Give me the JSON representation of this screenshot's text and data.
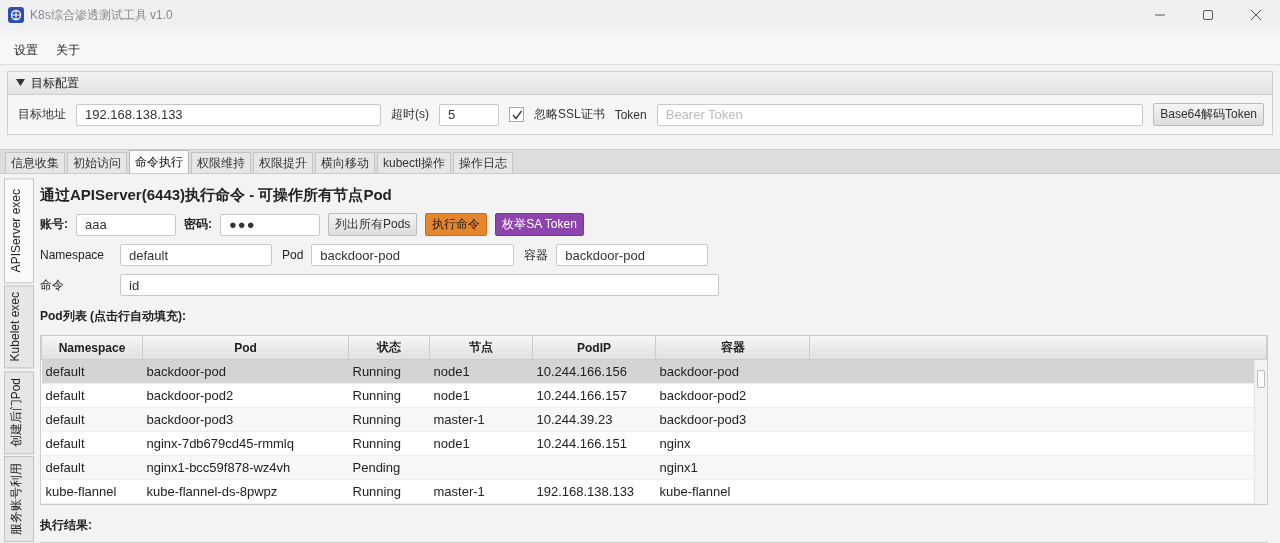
{
  "window": {
    "title": "K8s综合渗透测试工具 v1.0"
  },
  "menu": [
    "设置",
    "关于"
  ],
  "config": {
    "title": "目标配置",
    "expanded": true,
    "target_label": "目标地址",
    "target": "192.168.138.133",
    "timeout_label": "超时(s)",
    "timeout": "5",
    "ssl": {
      "label": "忽略SSL证书",
      "checked": true
    },
    "token_label": "Token",
    "token_placeholder": "Bearer Token",
    "decode_button": "Base64解码Token"
  },
  "tabs": [
    {
      "label": "信息收集",
      "selected": false
    },
    {
      "label": "初始访问",
      "selected": false
    },
    {
      "label": "命令执行",
      "selected": true
    },
    {
      "label": "权限维持",
      "selected": false
    },
    {
      "label": "权限提升",
      "selected": false
    },
    {
      "label": "横向移动",
      "selected": false
    },
    {
      "label": "kubectl操作",
      "selected": false
    },
    {
      "label": "操作日志",
      "selected": false
    }
  ],
  "side_tabs": [
    {
      "label": "APIServer exec",
      "selected": true
    },
    {
      "label": "Kubelet exec",
      "selected": false
    },
    {
      "label": "创建后门Pod",
      "selected": false
    },
    {
      "label": "服务账号利用",
      "selected": false
    }
  ],
  "heading": "通过APIServer(6443)执行命令 - 可操作所有节点Pod",
  "account_label": "账号:",
  "account": "aaa",
  "password_label": "密码:",
  "password": "●●●",
  "buttons": [
    {
      "label": "列出所有Pods",
      "kind": "plain"
    },
    {
      "label": "执行命令",
      "kind": "orange"
    },
    {
      "label": "枚举SA Token",
      "kind": "purple"
    }
  ],
  "fields": [
    {
      "label": "Namespace",
      "value": "default"
    },
    {
      "label": "Pod",
      "value": "backdoor-pod"
    },
    {
      "label": "容器",
      "value": "backdoor-pod"
    }
  ],
  "command_label": "命令",
  "command": "id",
  "table_label": "Pod列表 (点击行自动填充):",
  "table": {
    "columns": [
      "Namespace",
      "Pod",
      "状态",
      "节点",
      "PodIP",
      "容器"
    ],
    "rows": [
      {
        "cells": [
          "default",
          "backdoor-pod",
          "Running",
          "node1",
          "10.244.166.156",
          "backdoor-pod"
        ],
        "selected": true
      },
      {
        "cells": [
          "default",
          "backdoor-pod2",
          "Running",
          "node1",
          "10.244.166.157",
          "backdoor-pod2"
        ],
        "selected": false
      },
      {
        "cells": [
          "default",
          "backdoor-pod3",
          "Running",
          "master-1",
          "10.244.39.23",
          "backdoor-pod3"
        ],
        "selected": false
      },
      {
        "cells": [
          "default",
          "nginx-7db679cd45-rmmlq",
          "Running",
          "node1",
          "10.244.166.151",
          "nginx"
        ],
        "selected": false
      },
      {
        "cells": [
          "default",
          "nginx1-bcc59f878-wz4vh",
          "Pending",
          "",
          "",
          "nginx1"
        ],
        "selected": false
      },
      {
        "cells": [
          "kube-flannel",
          "kube-flannel-ds-8pwpz",
          "Running",
          "master-1",
          "192.168.138.133",
          "kube-flannel"
        ],
        "selected": false
      }
    ]
  },
  "result_label": "执行结果:"
}
